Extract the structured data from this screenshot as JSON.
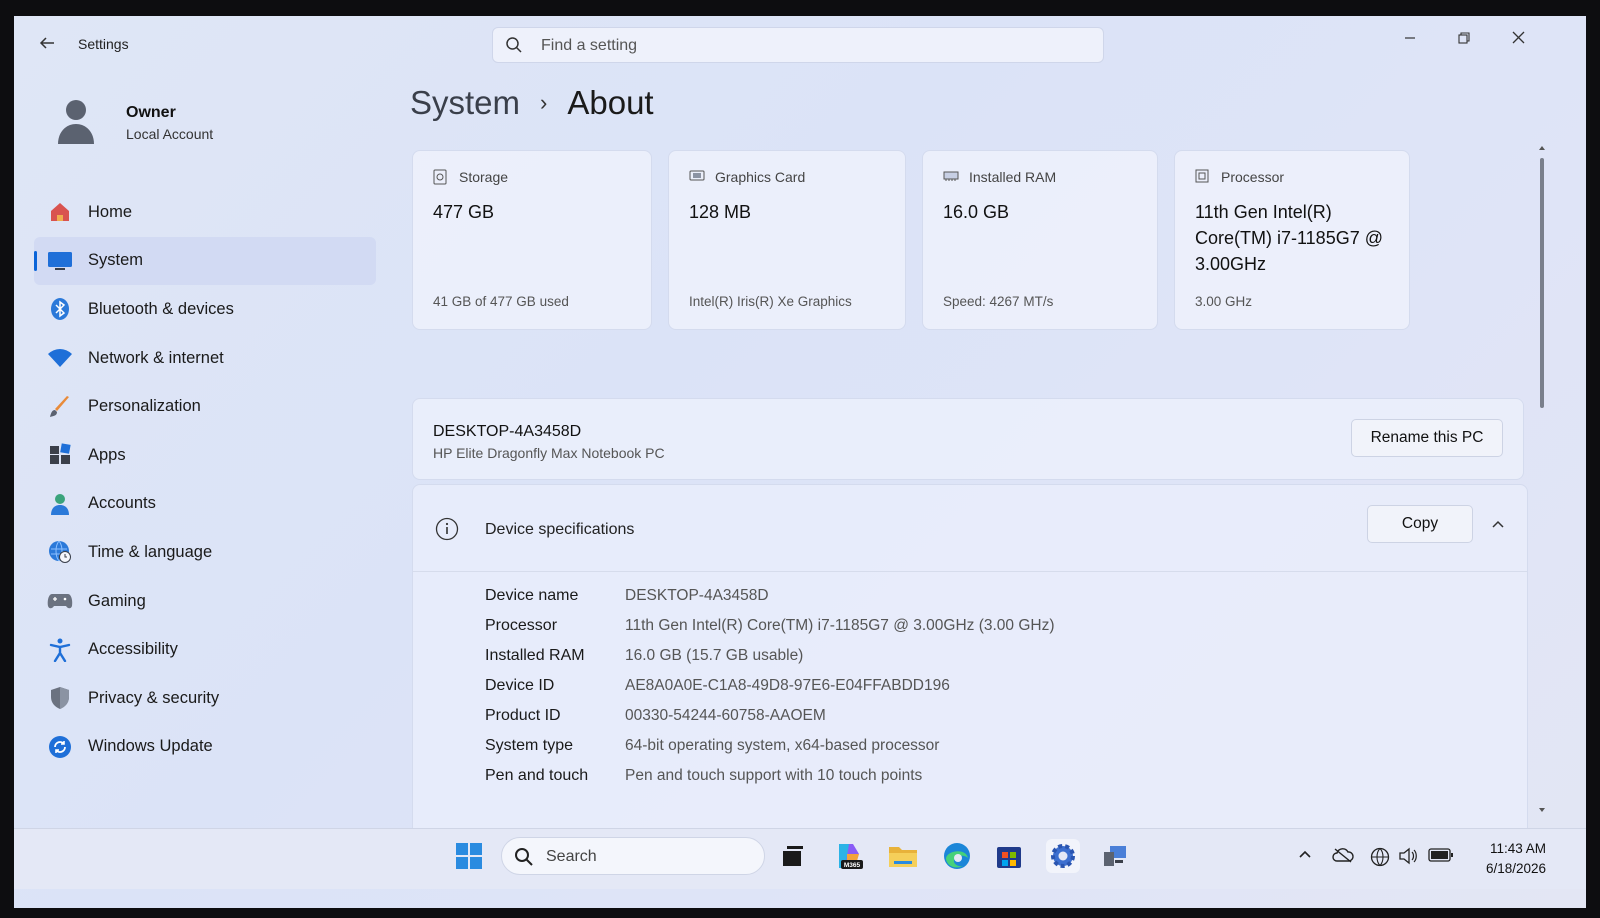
{
  "window": {
    "title": "Settings",
    "search_placeholder": "Find a setting",
    "controls": [
      "minimize-icon",
      "restore-icon",
      "close-icon"
    ]
  },
  "profile": {
    "name": "Owner",
    "account_type": "Local Account"
  },
  "sidebar": {
    "items": [
      {
        "label": "Home",
        "icon": "home-icon",
        "active": false
      },
      {
        "label": "System",
        "icon": "system-icon",
        "active": true
      },
      {
        "label": "Bluetooth & devices",
        "icon": "bluetooth-icon",
        "active": false
      },
      {
        "label": "Network & internet",
        "icon": "wifi-icon",
        "active": false
      },
      {
        "label": "Personalization",
        "icon": "brush-icon",
        "active": false
      },
      {
        "label": "Apps",
        "icon": "apps-icon",
        "active": false
      },
      {
        "label": "Accounts",
        "icon": "accounts-icon",
        "active": false
      },
      {
        "label": "Time & language",
        "icon": "globe-clock-icon",
        "active": false
      },
      {
        "label": "Gaming",
        "icon": "gamepad-icon",
        "active": false
      },
      {
        "label": "Accessibility",
        "icon": "accessibility-icon",
        "active": false
      },
      {
        "label": "Privacy & security",
        "icon": "shield-icon",
        "active": false
      },
      {
        "label": "Windows Update",
        "icon": "update-icon",
        "active": false
      }
    ]
  },
  "breadcrumb": {
    "parent": "System",
    "separator": "›",
    "current": "About"
  },
  "cards": [
    {
      "title": "Storage",
      "icon": "storage-icon",
      "value": "477 GB",
      "sub": "41 GB of 477 GB used"
    },
    {
      "title": "Graphics Card",
      "icon": "graphics-card-icon",
      "value": "128 MB",
      "sub": "Intel(R) Iris(R) Xe Graphics"
    },
    {
      "title": "Installed RAM",
      "icon": "ram-icon",
      "value": "16.0 GB",
      "sub": "Speed: 4267 MT/s"
    },
    {
      "title": "Processor",
      "icon": "processor-icon",
      "value": "11th Gen Intel(R) Core(TM) i7-1185G7 @ 3.00GHz",
      "sub": "3.00 GHz"
    }
  ],
  "pc": {
    "name": "DESKTOP-4A3458D",
    "model": "HP Elite Dragonfly Max Notebook PC",
    "rename_label": "Rename this PC"
  },
  "specs": {
    "title": "Device specifications",
    "copy_label": "Copy",
    "rows": [
      {
        "label": "Device name",
        "value": "DESKTOP-4A3458D"
      },
      {
        "label": "Processor",
        "value": "11th Gen Intel(R) Core(TM) i7-1185G7 @ 3.00GHz (3.00 GHz)"
      },
      {
        "label": "Installed RAM",
        "value": "16.0 GB (15.7 GB usable)"
      },
      {
        "label": "Device ID",
        "value": "AE8A0A0E-C1A8-49D8-97E6-E04FFABDD196"
      },
      {
        "label": "Product ID",
        "value": "00330-54244-60758-AAOEM"
      },
      {
        "label": "System type",
        "value": "64-bit operating system, x64-based processor"
      },
      {
        "label": "Pen and touch",
        "value": "Pen and touch support with 10 touch points"
      }
    ]
  },
  "taskbar": {
    "search_label": "Search",
    "apps": [
      "start-icon",
      "task-view-icon",
      "m365-copilot-icon",
      "file-explorer-icon",
      "edge-icon",
      "store-icon",
      "settings-icon",
      "pc-app-icon"
    ],
    "m365_badge": "M365",
    "time": "11:43 AM",
    "date": "6/18/2026"
  },
  "colors": {
    "accent": "#0a64d8",
    "background": "#dfe6f6"
  }
}
